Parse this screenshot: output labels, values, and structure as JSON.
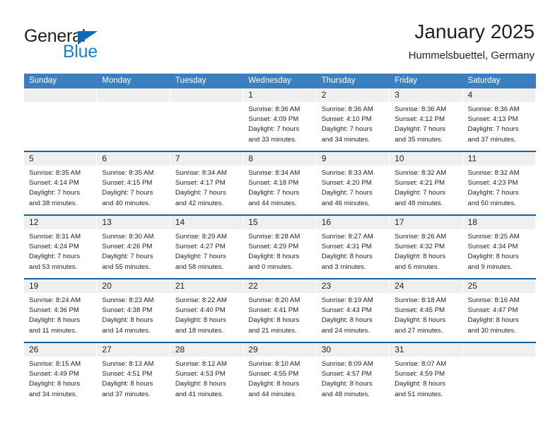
{
  "brand": {
    "name_part1": "General",
    "name_part2": "Blue",
    "accent_color": "#1a80d0",
    "triangle_color": "#0d6bb5"
  },
  "header": {
    "title": "January 2025",
    "location": "Hummelsbuettel, Germany"
  },
  "colors": {
    "header_row_bg": "#3c7fc1",
    "week_separator": "#1a5fa0",
    "day_band_bg": "#efefef",
    "text": "#231f20"
  },
  "day_names": [
    "Sunday",
    "Monday",
    "Tuesday",
    "Wednesday",
    "Thursday",
    "Friday",
    "Saturday"
  ],
  "weeks": [
    [
      {
        "day": "",
        "empty": true,
        "lines": []
      },
      {
        "day": "",
        "empty": true,
        "lines": []
      },
      {
        "day": "",
        "empty": true,
        "lines": []
      },
      {
        "day": "1",
        "empty": false,
        "lines": [
          "Sunrise: 8:36 AM",
          "Sunset: 4:09 PM",
          "Daylight: 7 hours",
          "and 33 minutes."
        ]
      },
      {
        "day": "2",
        "empty": false,
        "lines": [
          "Sunrise: 8:36 AM",
          "Sunset: 4:10 PM",
          "Daylight: 7 hours",
          "and 34 minutes."
        ]
      },
      {
        "day": "3",
        "empty": false,
        "lines": [
          "Sunrise: 8:36 AM",
          "Sunset: 4:12 PM",
          "Daylight: 7 hours",
          "and 35 minutes."
        ]
      },
      {
        "day": "4",
        "empty": false,
        "lines": [
          "Sunrise: 8:36 AM",
          "Sunset: 4:13 PM",
          "Daylight: 7 hours",
          "and 37 minutes."
        ]
      }
    ],
    [
      {
        "day": "5",
        "empty": false,
        "lines": [
          "Sunrise: 8:35 AM",
          "Sunset: 4:14 PM",
          "Daylight: 7 hours",
          "and 38 minutes."
        ]
      },
      {
        "day": "6",
        "empty": false,
        "lines": [
          "Sunrise: 8:35 AM",
          "Sunset: 4:15 PM",
          "Daylight: 7 hours",
          "and 40 minutes."
        ]
      },
      {
        "day": "7",
        "empty": false,
        "lines": [
          "Sunrise: 8:34 AM",
          "Sunset: 4:17 PM",
          "Daylight: 7 hours",
          "and 42 minutes."
        ]
      },
      {
        "day": "8",
        "empty": false,
        "lines": [
          "Sunrise: 8:34 AM",
          "Sunset: 4:18 PM",
          "Daylight: 7 hours",
          "and 44 minutes."
        ]
      },
      {
        "day": "9",
        "empty": false,
        "lines": [
          "Sunrise: 8:33 AM",
          "Sunset: 4:20 PM",
          "Daylight: 7 hours",
          "and 46 minutes."
        ]
      },
      {
        "day": "10",
        "empty": false,
        "lines": [
          "Sunrise: 8:32 AM",
          "Sunset: 4:21 PM",
          "Daylight: 7 hours",
          "and 48 minutes."
        ]
      },
      {
        "day": "11",
        "empty": false,
        "lines": [
          "Sunrise: 8:32 AM",
          "Sunset: 4:23 PM",
          "Daylight: 7 hours",
          "and 50 minutes."
        ]
      }
    ],
    [
      {
        "day": "12",
        "empty": false,
        "lines": [
          "Sunrise: 8:31 AM",
          "Sunset: 4:24 PM",
          "Daylight: 7 hours",
          "and 53 minutes."
        ]
      },
      {
        "day": "13",
        "empty": false,
        "lines": [
          "Sunrise: 8:30 AM",
          "Sunset: 4:26 PM",
          "Daylight: 7 hours",
          "and 55 minutes."
        ]
      },
      {
        "day": "14",
        "empty": false,
        "lines": [
          "Sunrise: 8:29 AM",
          "Sunset: 4:27 PM",
          "Daylight: 7 hours",
          "and 58 minutes."
        ]
      },
      {
        "day": "15",
        "empty": false,
        "lines": [
          "Sunrise: 8:28 AM",
          "Sunset: 4:29 PM",
          "Daylight: 8 hours",
          "and 0 minutes."
        ]
      },
      {
        "day": "16",
        "empty": false,
        "lines": [
          "Sunrise: 8:27 AM",
          "Sunset: 4:31 PM",
          "Daylight: 8 hours",
          "and 3 minutes."
        ]
      },
      {
        "day": "17",
        "empty": false,
        "lines": [
          "Sunrise: 8:26 AM",
          "Sunset: 4:32 PM",
          "Daylight: 8 hours",
          "and 6 minutes."
        ]
      },
      {
        "day": "18",
        "empty": false,
        "lines": [
          "Sunrise: 8:25 AM",
          "Sunset: 4:34 PM",
          "Daylight: 8 hours",
          "and 9 minutes."
        ]
      }
    ],
    [
      {
        "day": "19",
        "empty": false,
        "lines": [
          "Sunrise: 8:24 AM",
          "Sunset: 4:36 PM",
          "Daylight: 8 hours",
          "and 11 minutes."
        ]
      },
      {
        "day": "20",
        "empty": false,
        "lines": [
          "Sunrise: 8:23 AM",
          "Sunset: 4:38 PM",
          "Daylight: 8 hours",
          "and 14 minutes."
        ]
      },
      {
        "day": "21",
        "empty": false,
        "lines": [
          "Sunrise: 8:22 AM",
          "Sunset: 4:40 PM",
          "Daylight: 8 hours",
          "and 18 minutes."
        ]
      },
      {
        "day": "22",
        "empty": false,
        "lines": [
          "Sunrise: 8:20 AM",
          "Sunset: 4:41 PM",
          "Daylight: 8 hours",
          "and 21 minutes."
        ]
      },
      {
        "day": "23",
        "empty": false,
        "lines": [
          "Sunrise: 8:19 AM",
          "Sunset: 4:43 PM",
          "Daylight: 8 hours",
          "and 24 minutes."
        ]
      },
      {
        "day": "24",
        "empty": false,
        "lines": [
          "Sunrise: 8:18 AM",
          "Sunset: 4:45 PM",
          "Daylight: 8 hours",
          "and 27 minutes."
        ]
      },
      {
        "day": "25",
        "empty": false,
        "lines": [
          "Sunrise: 8:16 AM",
          "Sunset: 4:47 PM",
          "Daylight: 8 hours",
          "and 30 minutes."
        ]
      }
    ],
    [
      {
        "day": "26",
        "empty": false,
        "lines": [
          "Sunrise: 8:15 AM",
          "Sunset: 4:49 PM",
          "Daylight: 8 hours",
          "and 34 minutes."
        ]
      },
      {
        "day": "27",
        "empty": false,
        "lines": [
          "Sunrise: 8:13 AM",
          "Sunset: 4:51 PM",
          "Daylight: 8 hours",
          "and 37 minutes."
        ]
      },
      {
        "day": "28",
        "empty": false,
        "lines": [
          "Sunrise: 8:12 AM",
          "Sunset: 4:53 PM",
          "Daylight: 8 hours",
          "and 41 minutes."
        ]
      },
      {
        "day": "29",
        "empty": false,
        "lines": [
          "Sunrise: 8:10 AM",
          "Sunset: 4:55 PM",
          "Daylight: 8 hours",
          "and 44 minutes."
        ]
      },
      {
        "day": "30",
        "empty": false,
        "lines": [
          "Sunrise: 8:09 AM",
          "Sunset: 4:57 PM",
          "Daylight: 8 hours",
          "and 48 minutes."
        ]
      },
      {
        "day": "31",
        "empty": false,
        "lines": [
          "Sunrise: 8:07 AM",
          "Sunset: 4:59 PM",
          "Daylight: 8 hours",
          "and 51 minutes."
        ]
      },
      {
        "day": "",
        "empty": true,
        "lines": []
      }
    ]
  ]
}
